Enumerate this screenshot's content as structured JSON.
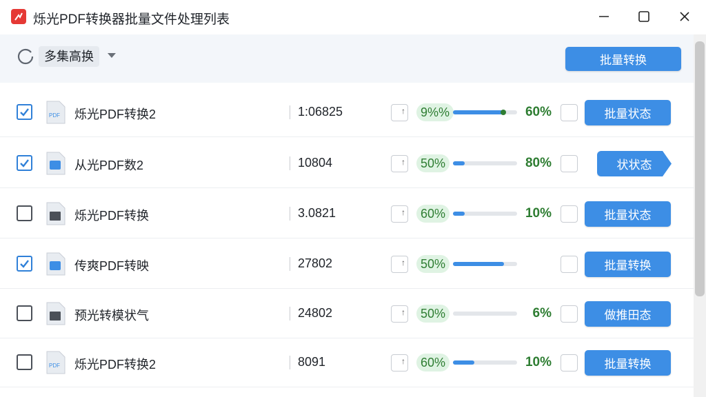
{
  "window": {
    "title": "烁光PDF转换器批量文件处理列表",
    "app_icon": "pdf-app-icon",
    "controls": [
      "minimize-icon",
      "maximize-icon",
      "close-icon"
    ]
  },
  "toolbar": {
    "mode_label": "多集高换",
    "batch_button": "批量转换"
  },
  "colors": {
    "accent": "#3d8ee5",
    "progress_green": "#2e7d32",
    "pill_bg": "#dff3e3",
    "app_red": "#e53935"
  },
  "rows": [
    {
      "checked": true,
      "icon": "pdf-file-icon",
      "name": "烁光PDF转换2",
      "size": "1:06825",
      "pill": "9%%",
      "progress": 0.78,
      "right_pct": "60%",
      "action": "批量状态",
      "action_shape": "rect"
    },
    {
      "checked": true,
      "icon": "blue-file-icon",
      "name": "从光PDF数2",
      "size": "10804",
      "pill": "50%",
      "progress": 0.18,
      "right_pct": "80%",
      "action": "状状态",
      "action_shape": "arrow"
    },
    {
      "checked": false,
      "icon": "dark-file-icon",
      "name": "烁光PDF转换",
      "size": "3.0821",
      "pill": "60%",
      "progress": 0.18,
      "right_pct": "10%",
      "action": "批量状态",
      "action_shape": "rect"
    },
    {
      "checked": true,
      "icon": "blue-file-icon",
      "name": "传爽PDF转映",
      "size": "27802",
      "pill": "50%",
      "progress": 0.8,
      "right_pct": "",
      "action": "批量转换",
      "action_shape": "rect"
    },
    {
      "checked": false,
      "icon": "dark-file-icon",
      "name": "预光转模状气",
      "size": "24802",
      "pill": "50%",
      "progress": 0.0,
      "right_pct": "6%",
      "action": "做推田态",
      "action_shape": "rect"
    },
    {
      "checked": false,
      "icon": "pdf-file-icon",
      "name": "烁光PDF转换2",
      "size": "8091",
      "pill": "60%",
      "progress": 0.33,
      "right_pct": "10%",
      "action": "批量转换",
      "action_shape": "rect"
    }
  ]
}
